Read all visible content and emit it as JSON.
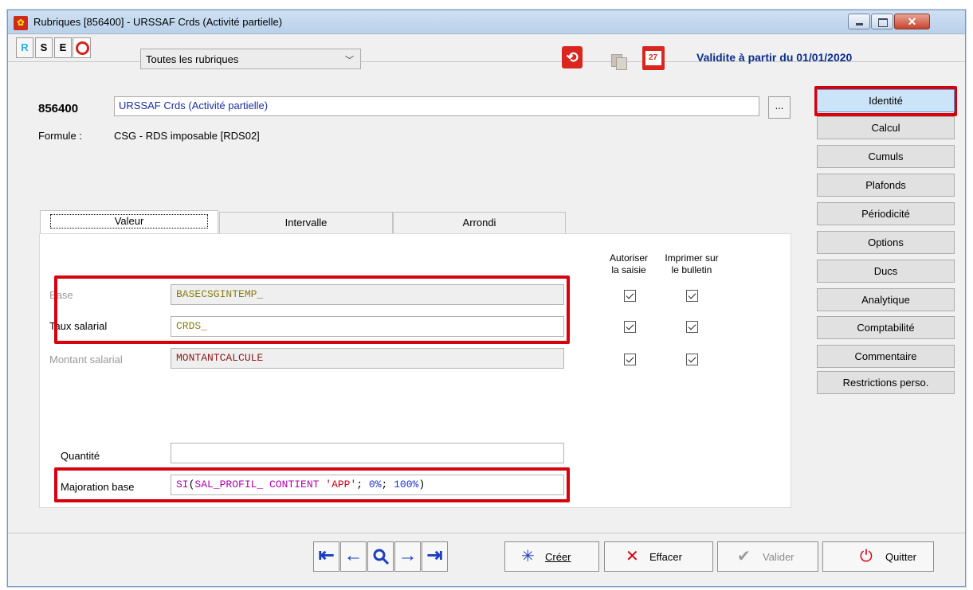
{
  "window": {
    "title": "Rubriques [856400] - URSSAF Crds (Activité partielle)",
    "close_glyph": "✕"
  },
  "toolbar": {
    "mode_buttons": [
      "R",
      "S",
      "E"
    ],
    "filter_select": "Toutes les rubriques",
    "validity": "Validite à partir du 01/01/2020"
  },
  "header": {
    "code": "856400",
    "name": "URSSAF Crds (Activité partielle)",
    "ellipsis": "...",
    "formule_label": "Formule :",
    "formule_value": "CSG - RDS imposable [RDS02]"
  },
  "tabs": [
    "Valeur",
    "Intervalle",
    "Arrondi"
  ],
  "form": {
    "col_autoriser": "Autoriser la saisie",
    "col_autoriser_1": "Autoriser",
    "col_autoriser_2": "la saisie",
    "col_imprimer_1": "Imprimer sur",
    "col_imprimer_2": "le bulletin",
    "rows": [
      {
        "label": "Base",
        "value": "BASECSGINTEMP_",
        "value_color": "#8a7d12",
        "autoriser": true,
        "imprimer": true
      },
      {
        "label": "Taux salarial",
        "value": "CRDS_",
        "value_color": "#8a7d12",
        "autoriser": true,
        "imprimer": true
      },
      {
        "label": "Montant salarial",
        "value": "MONTANTCALCULE",
        "value_color": "#8b1a1a",
        "autoriser": true,
        "imprimer": true
      }
    ],
    "quantite_label": "Quantité",
    "quantite_value": "",
    "majoration_label": "Majoration base",
    "majoration_tokens": [
      {
        "text": "SI",
        "color": "#b000b0"
      },
      {
        "text": "(",
        "color": "#000000"
      },
      {
        "text": "SAL_PROFIL_",
        "color": "#b000b0"
      },
      {
        "text": " CONTIENT ",
        "color": "#b000b0"
      },
      {
        "text": "'APP'",
        "color": "#d0001c"
      },
      {
        "text": "; ",
        "color": "#000000"
      },
      {
        "text": "0%",
        "color": "#1c2fd0"
      },
      {
        "text": "; ",
        "color": "#000000"
      },
      {
        "text": "100%",
        "color": "#1c2fd0"
      },
      {
        "text": ")",
        "color": "#000000"
      }
    ]
  },
  "sidebar": [
    "Identité",
    "Calcul",
    "Cumuls",
    "Plafonds",
    "Périodicité",
    "Options",
    "Ducs",
    "Analytique",
    "Comptabilité",
    "Commentaire",
    "Restrictions perso."
  ],
  "bottom": {
    "nav": [
      "⇤",
      "←",
      "search-icon",
      "→",
      "⇥"
    ],
    "creer": "Créer",
    "effacer": "Effacer",
    "valider": "Valider",
    "quitter": "Quitter"
  },
  "colors": {
    "highlight": "#d7000f",
    "active_sidebar": "#cce4f7",
    "validity_text": "#0b2e8c"
  }
}
